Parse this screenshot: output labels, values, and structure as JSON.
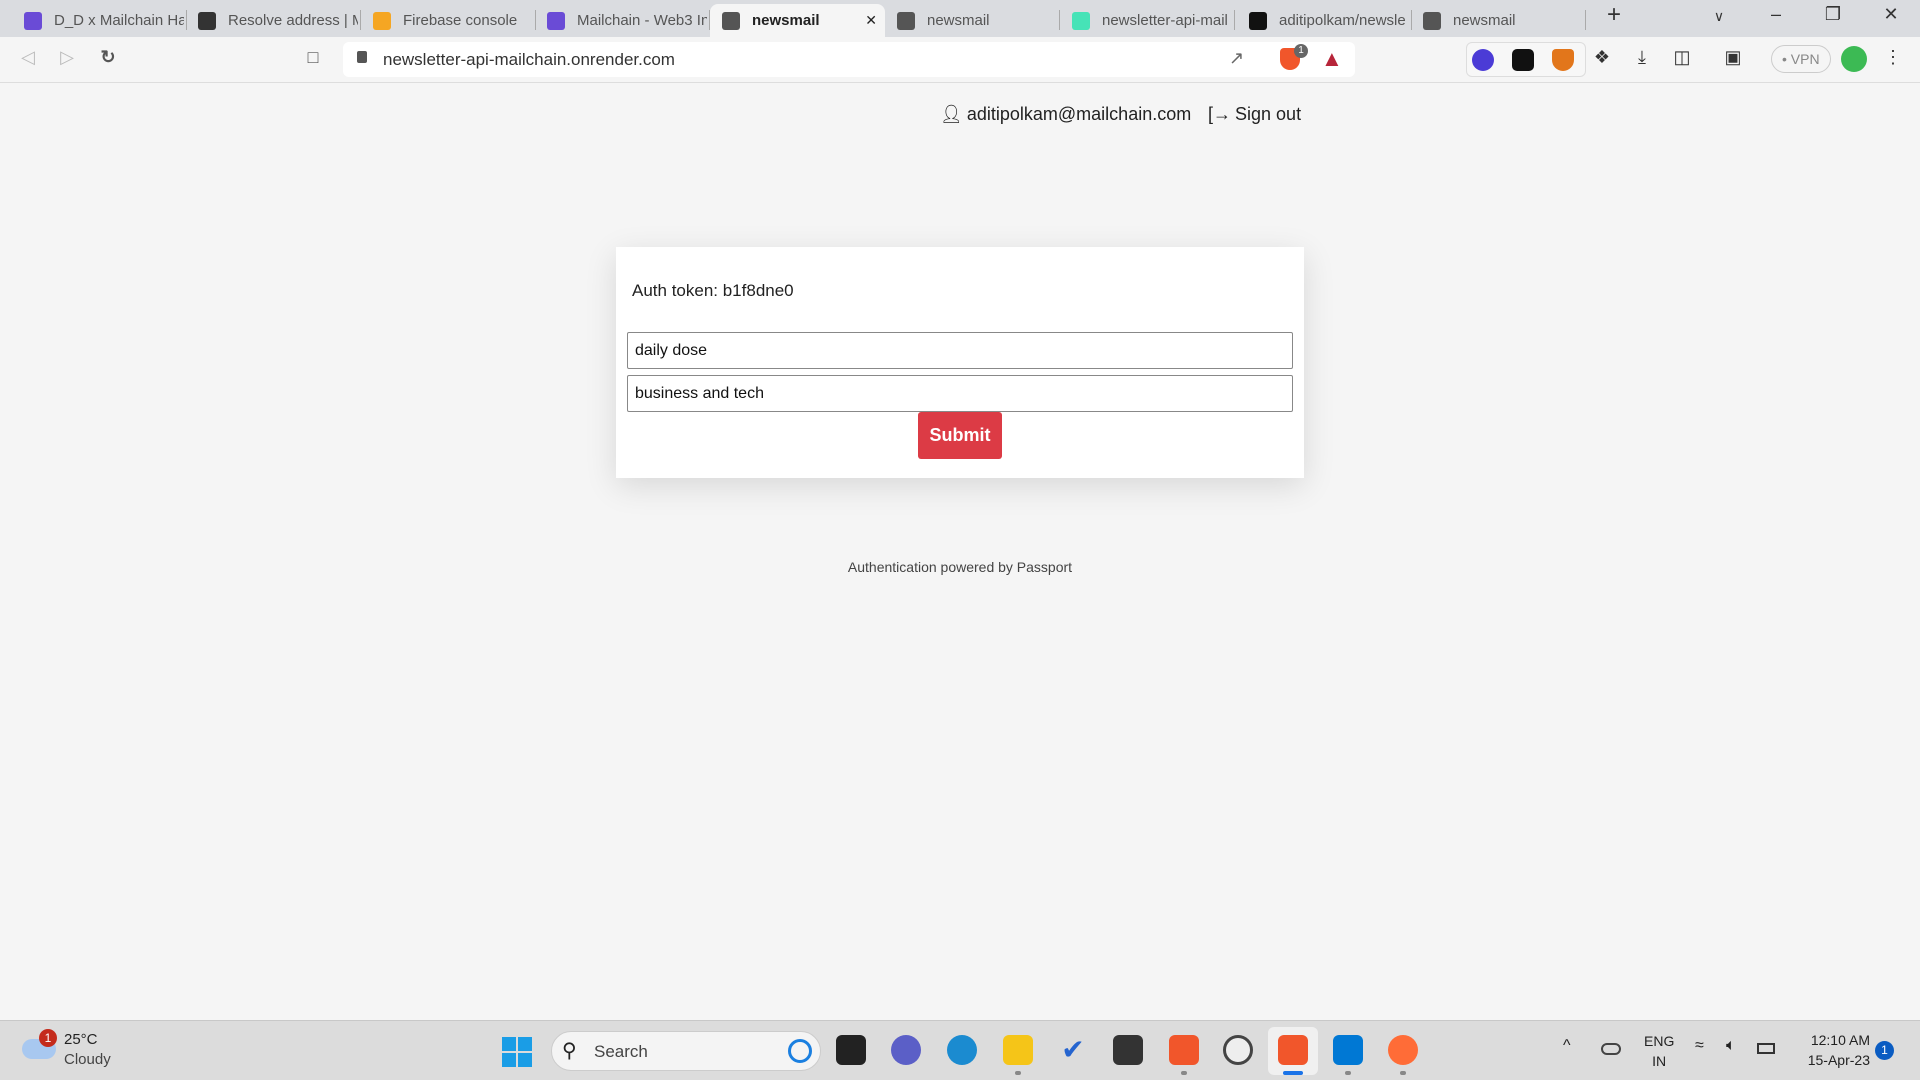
{
  "browser": {
    "tabs": [
      {
        "title": "D_D x Mailchain Ha",
        "icon": "mailchain-icon",
        "color": "#6a4bd6"
      },
      {
        "title": "Resolve address | M",
        "icon": "resolve-icon",
        "color": "#333333"
      },
      {
        "title": "Firebase console",
        "icon": "firebase-icon",
        "color": "#f5a623"
      },
      {
        "title": "Mailchain - Web3 In",
        "icon": "mailchain-icon",
        "color": "#6a4bd6"
      },
      {
        "title": "newsmail",
        "icon": "globe-icon",
        "color": "#555555",
        "active": true
      },
      {
        "title": "newsmail",
        "icon": "globe-icon",
        "color": "#555555"
      },
      {
        "title": "newsletter-api-mail",
        "icon": "render-icon",
        "color": "#46e3b7"
      },
      {
        "title": "aditipolkam/newsle",
        "icon": "github-icon",
        "color": "#111111"
      },
      {
        "title": "newsmail",
        "icon": "globe-icon",
        "color": "#555555"
      }
    ],
    "url": "newsletter-api-mailchain.onrender.com",
    "shields_count": "1",
    "vpn_label": "VPN"
  },
  "header": {
    "user_email": "aditipolkam@mailchain.com",
    "sign_out": "Sign out"
  },
  "card": {
    "auth_token": "Auth token: b1f8dne0",
    "input1_value": "daily dose",
    "input2_value": "business and tech",
    "submit_label": "Submit"
  },
  "footer": "Authentication powered by Passport",
  "taskbar": {
    "weather_temp": "25°C",
    "weather_desc": "Cloudy",
    "weather_badge": "1",
    "search_placeholder": "Search",
    "lang1": "ENG",
    "lang2": "IN",
    "time": "12:10 AM",
    "date": "15-Apr-23",
    "notif_count": "1"
  },
  "colors": {
    "accent": "#dc3b45"
  }
}
